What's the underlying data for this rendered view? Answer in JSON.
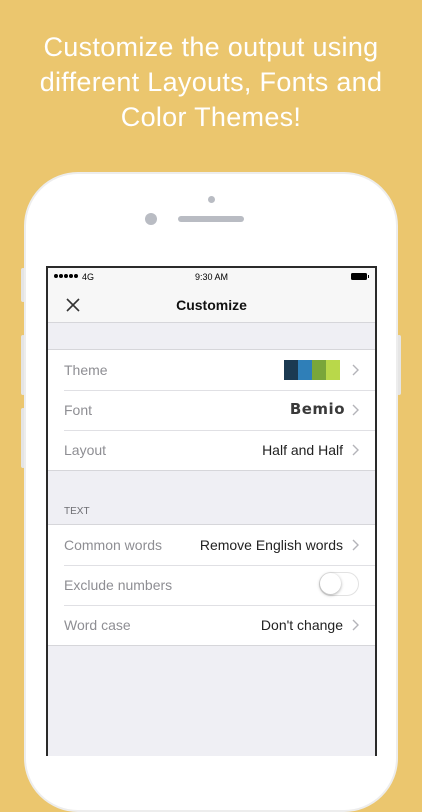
{
  "headline": {
    "line1": "Customize the output using",
    "line2": "different Layouts, Fonts and",
    "line3": "Color Themes!"
  },
  "status_bar": {
    "carrier": "4G",
    "time": "9:30 AM"
  },
  "nav": {
    "title": "Customize",
    "close_icon": "close-icon"
  },
  "settings": {
    "theme": {
      "label": "Theme",
      "swatches": [
        "#1b3a52",
        "#2f7fb8",
        "#7aa63a",
        "#b9d84a"
      ]
    },
    "font": {
      "label": "Font",
      "value": "Bemio"
    },
    "layout": {
      "label": "Layout",
      "value": "Half and Half"
    }
  },
  "text_section": {
    "header": "TEXT",
    "common_words": {
      "label": "Common words",
      "value": "Remove English words"
    },
    "exclude_numbers": {
      "label": "Exclude numbers",
      "enabled": false
    },
    "word_case": {
      "label": "Word case",
      "value": "Don't change"
    }
  },
  "colors": {
    "background": "#ebc66e",
    "headline": "#ffffff"
  }
}
